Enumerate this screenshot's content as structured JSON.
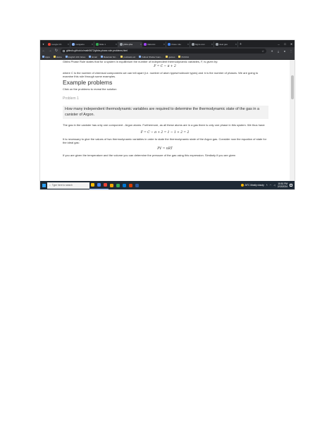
{
  "browser": {
    "tabs": [
      {
        "label": "Google Ch",
        "favicon": "#ea4335",
        "active": false
      },
      {
        "label": "mangalco",
        "favicon": "#8ab4f8",
        "active": false
      },
      {
        "label": "Slide 1",
        "favicon": "#34a853",
        "active": false
      },
      {
        "label": "gibbs-pha",
        "favicon": "#9aa0a6",
        "active": true
      },
      {
        "label": "Diatomic",
        "favicon": "#a142f4",
        "active": false
      },
      {
        "label": "phase rule",
        "favicon": "#4285f4",
        "active": false
      },
      {
        "label": "Signs.com",
        "favicon": "#9aa0a6",
        "active": false
      },
      {
        "label": "ideal gas",
        "favicon": "#9aa0a6",
        "active": false
      }
    ],
    "url": "gibbsfu.github.io/math5672/gibbs-phase-rule-problems.html",
    "bookmarks": [
      {
        "label": "Apps",
        "folder": false
      },
      {
        "label": "Home",
        "folder": true
      },
      {
        "label": "English 101 Notes",
        "folder": false
      },
      {
        "label": "Email",
        "folder": false
      },
      {
        "label": "Materials Sci...",
        "folder": false
      },
      {
        "label": "podcasts etc",
        "folder": true
      },
      {
        "label": "Fallout Shelter Gam...",
        "folder": false
      },
      {
        "label": "games",
        "folder": true
      },
      {
        "label": "DUUUA",
        "folder": true
      }
    ]
  },
  "page": {
    "intro": "Gibbs Phase Rule states that for a system in equilibrium the number of independent thermodynamic variables, F, is given by:",
    "formula1": "F = C − π + 2",
    "where": "where C is the number of chemical components we can tell apart (i.e. number of atom types/molecule types) and π is the number of phases. We are going to examine this rule through some examples.",
    "heading": "Example problems",
    "click_hint": "Click on the problems to reveal the solution",
    "problem_label": "Problem 1",
    "question": "How many independent thermodynamic variables are required to determine the thermodynamic state of the gas in a canister of Argon.",
    "sol1": "The gas in the canister has only one component - Argon atoms. Furthermore, as all these atoms are in a gas there is only one phase in this system. We thus have:",
    "formula2": "F = C − π + 2 = 1 − 1 + 2 = 2",
    "sol2": "It is necessary to give the values of two thermodynamic variables in order to state the thermodynamic state of the Argon gas. Consider now the equation of state for the ideal gas:",
    "formula3": "PV = nRT",
    "sol3": "If you are given the temperature and the volume you can determine the pressure of the gas using this expression. Similarly if you are given"
  },
  "taskbar": {
    "search_placeholder": "Type here to search",
    "weather": "26°C  Mostly cloudy",
    "time": "10:51 PM",
    "date": "2/13/2024",
    "apps": [
      "#fbbc05",
      "#4285f4",
      "#ea4335",
      "#f2a600",
      "#34a853",
      "#0078d4",
      "#d83b01",
      "#2b579a"
    ]
  }
}
